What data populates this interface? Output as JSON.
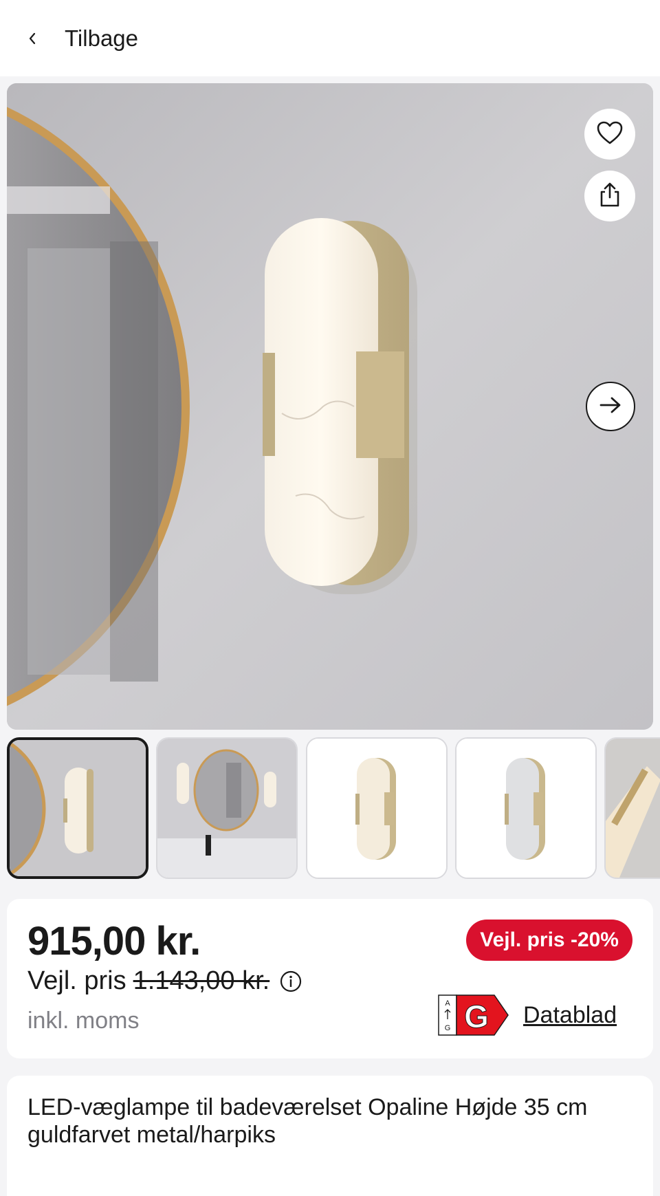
{
  "header": {
    "back_label": "Tilbage",
    "back_icon": "chevron-left-icon"
  },
  "gallery": {
    "favorite_icon": "heart-icon",
    "share_icon": "share-icon",
    "next_icon": "arrow-right-icon",
    "thumbnail_count_visible": 5,
    "active_thumbnail": 1
  },
  "price": {
    "current": "915,00 kr.",
    "rrp_label": "Vejl. pris",
    "rrp_old": "1.143,00 kr.",
    "vat_note": "inkl. moms",
    "discount_badge": "Vejl. pris -20%",
    "energy_class": "G",
    "energy_scale_top": "A",
    "energy_scale_bottom": "G",
    "datasheet_link": "Datablad"
  },
  "product": {
    "title": "LED-væglampe til badeværelset Opaline Højde 35 cm guldfarvet metal/harpiks"
  },
  "colors": {
    "badge_red": "#d9112e",
    "text": "#1a1a1a",
    "muted": "#808086",
    "background": "#f4f4f6"
  }
}
